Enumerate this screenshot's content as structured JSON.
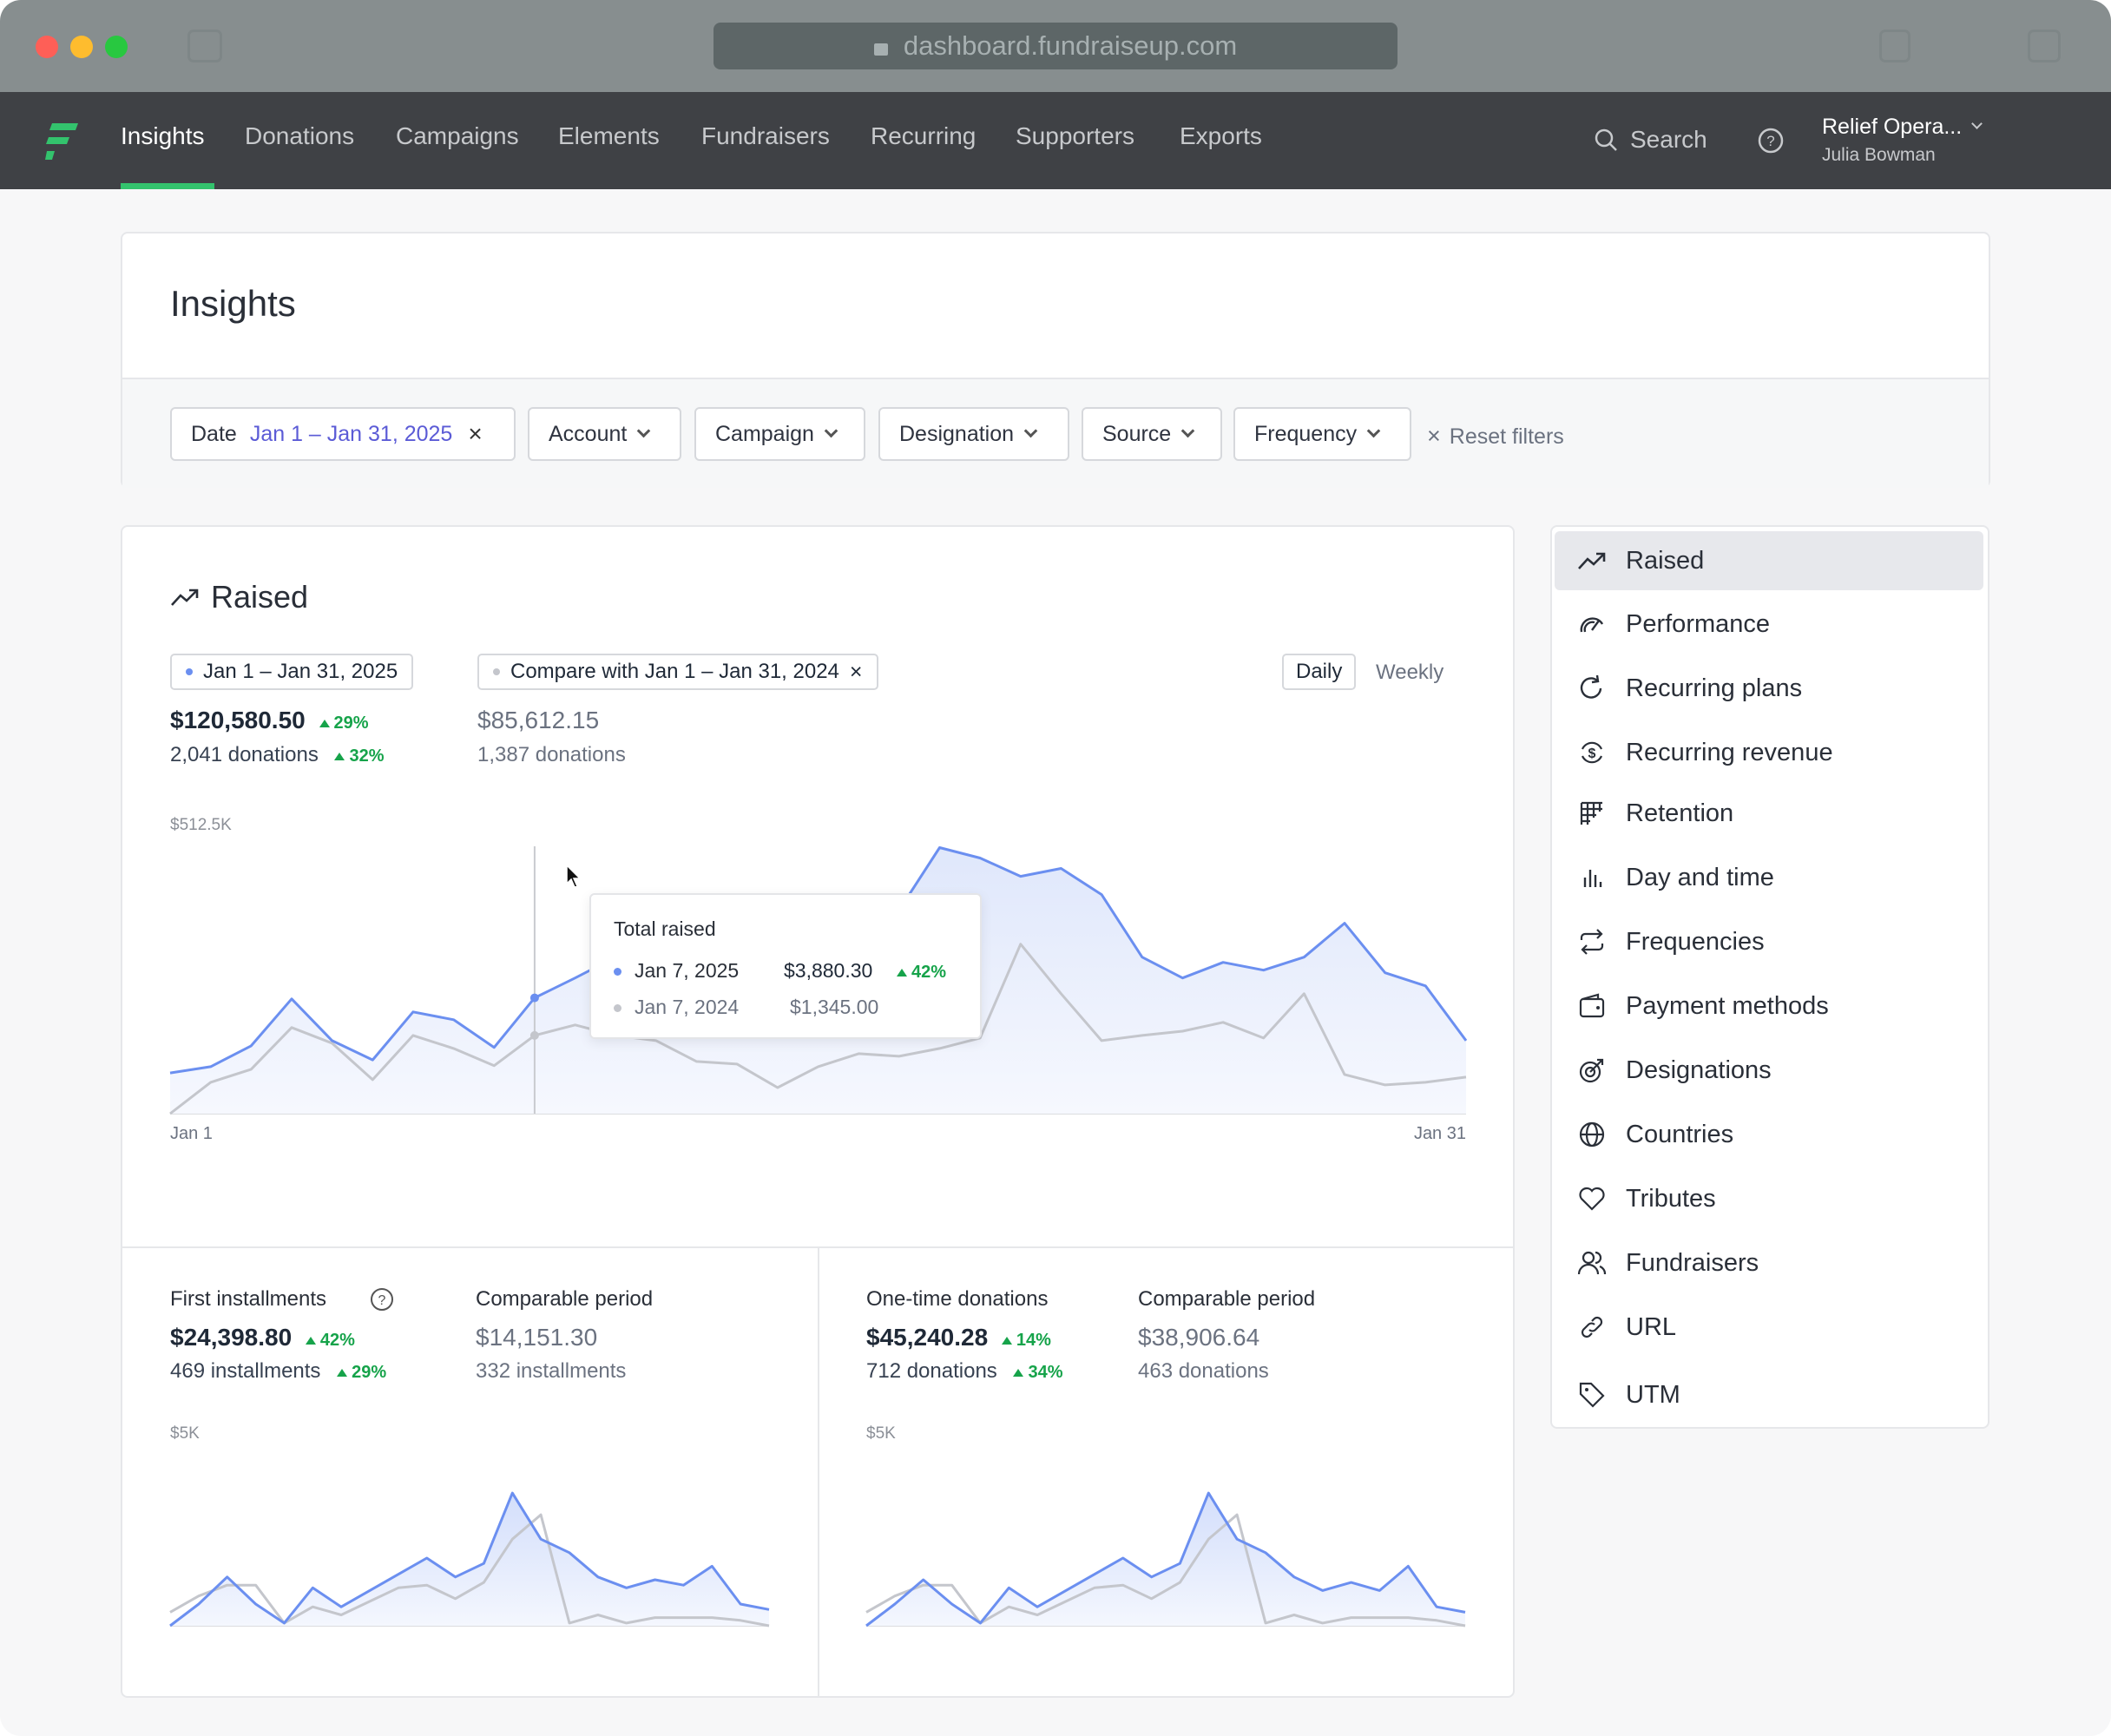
{
  "browser": {
    "url": "dashboard.fundraiseup.com"
  },
  "nav": {
    "items": [
      "Insights",
      "Donations",
      "Campaigns",
      "Elements",
      "Fundraisers",
      "Recurring",
      "Supporters",
      "Exports"
    ],
    "search": "Search",
    "account_name": "Relief Opera...",
    "user_name": "Julia Bowman"
  },
  "page": {
    "title": "Insights"
  },
  "filters": {
    "date_label": "Date",
    "date_value": "Jan 1 – Jan 31, 2025",
    "account": "Account",
    "campaign": "Campaign",
    "designation": "Designation",
    "source": "Source",
    "frequency": "Frequency",
    "reset": "Reset filters"
  },
  "raised": {
    "title": "Raised",
    "period_chip": "Jan 1 – Jan 31, 2025",
    "compare_chip": "Compare with Jan 1 – Jan 31, 2024",
    "granularity": [
      "Daily",
      "Weekly"
    ],
    "total": "$120,580.50",
    "total_change": "29%",
    "donations": "2,041 donations",
    "donations_change": "32%",
    "compare_total": "$85,612.15",
    "compare_donations": "1,387 donations",
    "y_max_label": "$512.5K",
    "x_start": "Jan 1",
    "x_end": "Jan 31",
    "tooltip": {
      "title": "Total raised",
      "current_date": "Jan 7, 2025",
      "current_value": "$3,880.30",
      "change": "42%",
      "prev_date": "Jan 7, 2024",
      "prev_value": "$1,345.00"
    }
  },
  "first_installments": {
    "title": "First installments",
    "value": "$24,398.80",
    "change": "42%",
    "count": "469 installments",
    "count_change": "29%",
    "compare_label": "Comparable period",
    "compare_value": "$14,151.30",
    "compare_count": "332 installments",
    "y_label": "$5K"
  },
  "one_time": {
    "title": "One-time donations",
    "value": "$45,240.28",
    "change": "14%",
    "count": "712 donations",
    "count_change": "34%",
    "compare_label": "Comparable period",
    "compare_value": "$38,906.64",
    "compare_count": "463 donations",
    "y_label": "$5K"
  },
  "sidebar": {
    "items": [
      {
        "label": "Raised",
        "icon": "trend-up-icon"
      },
      {
        "label": "Performance",
        "icon": "gauge-icon"
      },
      {
        "label": "Recurring plans",
        "icon": "refresh-icon"
      },
      {
        "label": "Recurring revenue",
        "icon": "dollar-cycle-icon"
      },
      {
        "label": "Retention",
        "icon": "grid-icon"
      },
      {
        "label": "Day and time",
        "icon": "bars-icon"
      },
      {
        "label": "Frequencies",
        "icon": "repeat-icon"
      },
      {
        "label": "Payment methods",
        "icon": "wallet-icon"
      },
      {
        "label": "Designations",
        "icon": "target-icon"
      },
      {
        "label": "Countries",
        "icon": "globe-icon"
      },
      {
        "label": "Tributes",
        "icon": "heart-icon"
      },
      {
        "label": "Fundraisers",
        "icon": "users-icon"
      },
      {
        "label": "URL",
        "icon": "link-icon"
      },
      {
        "label": "UTM",
        "icon": "tag-icon"
      }
    ]
  },
  "colors": {
    "current": "#6b8ff0",
    "compare": "#c4c6cc",
    "brand": "#33c36d",
    "positive": "#16a34a"
  },
  "chart_data": [
    {
      "type": "area",
      "title": "Raised",
      "x_range": [
        "Jan 1",
        "Jan 31"
      ],
      "ylim": [
        0,
        512500
      ],
      "series": [
        {
          "name": "Jan 1 – Jan 31, 2025",
          "values": [
            78000,
            90000,
            130000,
            220000,
            140000,
            103000,
            195000,
            180000,
            127000,
            222000,
            260000,
            300000,
            320000,
            290000,
            250000,
            230000,
            260000,
            345000,
            390000,
            510000,
            490000,
            455000,
            470000,
            420000,
            300000,
            260000,
            290000,
            275000,
            300000,
            365000,
            270000,
            245000,
            140000
          ]
        },
        {
          "name": "Compare with Jan 1 – Jan 31, 2024",
          "values": [
            0,
            60000,
            85000,
            165000,
            135000,
            65000,
            150000,
            125000,
            92000,
            150000,
            170000,
            150000,
            140000,
            100000,
            95000,
            50000,
            90000,
            115000,
            110000,
            125000,
            145000,
            325000,
            230000,
            140000,
            150000,
            158000,
            175000,
            145000,
            230000,
            75000,
            55000,
            60000,
            70000
          ]
        }
      ]
    },
    {
      "type": "area",
      "title": "First installments",
      "ylim": [
        0,
        5000
      ],
      "series": [
        {
          "name": "Current",
          "values": [
            0,
            800,
            1800,
            800,
            100,
            1400,
            700,
            1300,
            1900,
            2500,
            1800,
            2300,
            4900,
            3200,
            2700,
            1800,
            1400,
            1700,
            1500,
            2200,
            800,
            600
          ]
        },
        {
          "name": "Comparable period",
          "values": [
            500,
            1100,
            1500,
            1500,
            100,
            700,
            400,
            900,
            1400,
            1500,
            1000,
            1600,
            3200,
            4100,
            100,
            400,
            100,
            300,
            300,
            300,
            200,
            0
          ]
        }
      ]
    },
    {
      "type": "area",
      "title": "One-time donations",
      "ylim": [
        0,
        5000
      ],
      "series": [
        {
          "name": "Current",
          "values": [
            0,
            800,
            1700,
            800,
            100,
            1400,
            700,
            1300,
            1900,
            2500,
            1800,
            2300,
            4900,
            3200,
            2700,
            1800,
            1300,
            1600,
            1300,
            2200,
            700,
            500
          ]
        },
        {
          "name": "Comparable period",
          "values": [
            500,
            1100,
            1500,
            1500,
            100,
            700,
            400,
            900,
            1400,
            1500,
            1000,
            1600,
            3200,
            4100,
            100,
            400,
            100,
            300,
            300,
            300,
            200,
            0
          ]
        }
      ]
    }
  ]
}
